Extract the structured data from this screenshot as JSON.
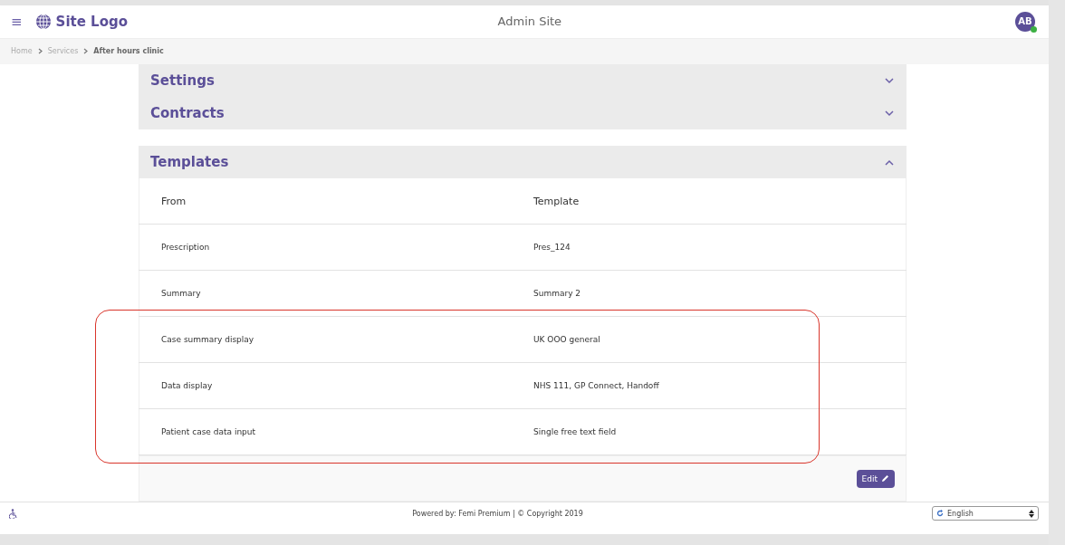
{
  "header": {
    "menu_icon": "≡",
    "logo": "Site Logo",
    "title": "Admin Site",
    "avatar": "AB",
    "online": true
  },
  "breadcrumb": [
    {
      "label": "Home",
      "current": false
    },
    {
      "label": "Services",
      "current": false
    },
    {
      "label": "After hours clinic",
      "current": true
    }
  ],
  "sections": [
    {
      "title": "Settings",
      "expanded": false
    },
    {
      "title": "Contracts",
      "expanded": false
    },
    {
      "title": "Templates",
      "expanded": true,
      "columns": [
        "From",
        "Template"
      ],
      "rows": [
        {
          "from": "Prescription",
          "template": "Pres_124"
        },
        {
          "from": "Summary",
          "template": "Summary 2"
        },
        {
          "from": "Case summary display",
          "template": "UK OOO general"
        },
        {
          "from": "Data display",
          "template": "NHS 111, GP Connect, Handoff"
        },
        {
          "from": "Patient case data input",
          "template": "Single free text field"
        }
      ],
      "button": "Edit"
    }
  ],
  "footer": {
    "text": "Powered by: Femi Premium | © Copyright 2019",
    "language": "English"
  }
}
